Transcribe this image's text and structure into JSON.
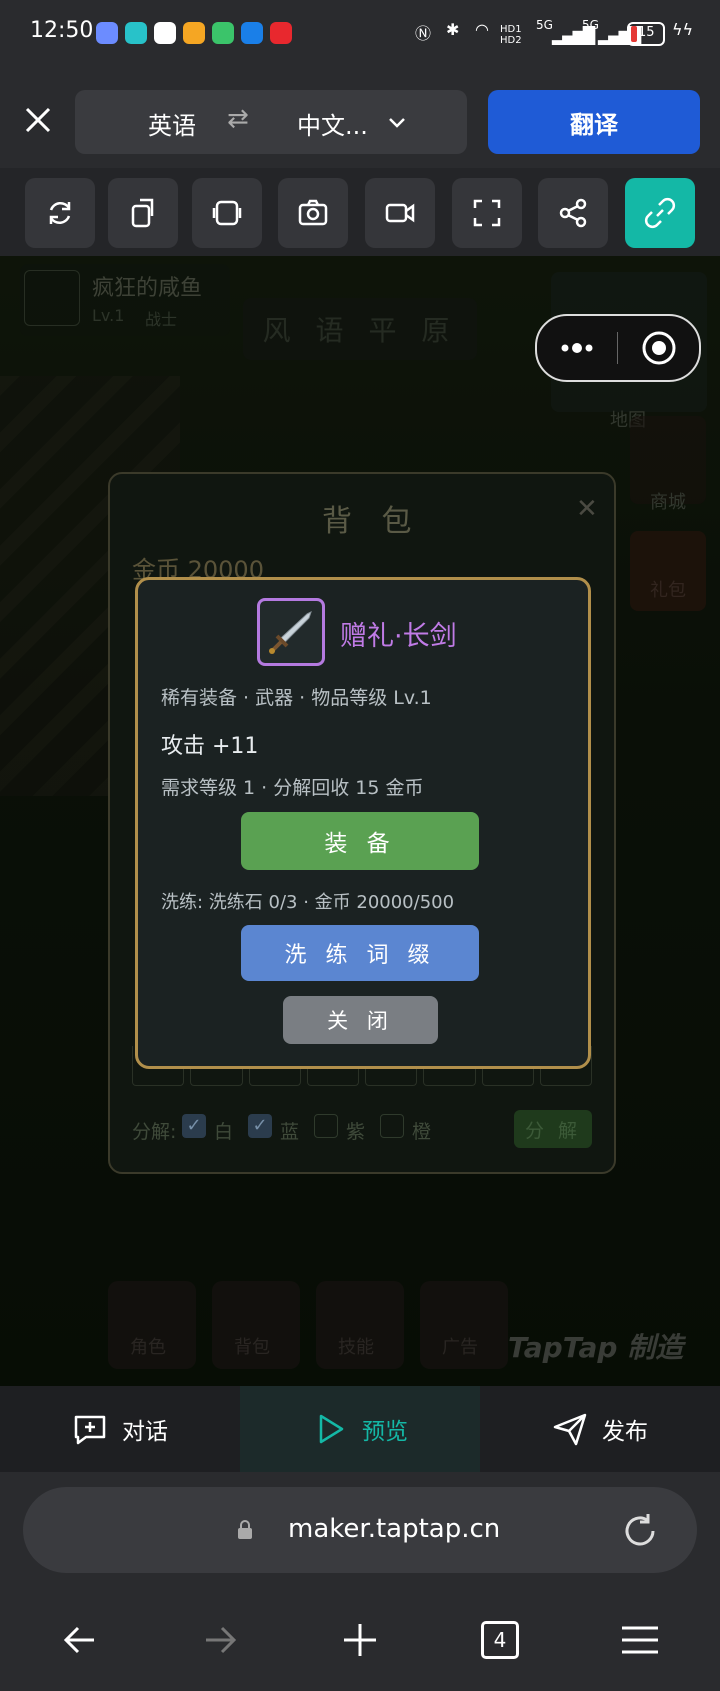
{
  "status_bar": {
    "time": "12:50",
    "battery": "15",
    "signal1": "5G",
    "signal2": "5G",
    "hd": "HD1 HD2"
  },
  "translate_bar": {
    "source_lang": "英语",
    "swap_symbol": "⇄",
    "target_lang": "中文...",
    "translate_label": "翻译"
  },
  "game": {
    "player_name": "疯狂的咸鱼",
    "player_level": "Lv.1",
    "player_class": "战士",
    "area_name": "风 语 平 原",
    "side_labels": [
      "地图",
      "商城",
      "礼包"
    ],
    "bottom_menu": [
      "角色",
      "背包",
      "技能",
      "广告"
    ],
    "watermark": "TapTap 制造"
  },
  "backpack": {
    "title": "背 包",
    "gold": "金币 20000",
    "decompose_label": "分解:",
    "filters": [
      {
        "label": "白",
        "checked": true
      },
      {
        "label": "蓝",
        "checked": true
      },
      {
        "label": "紫",
        "checked": false
      },
      {
        "label": "橙",
        "checked": false
      }
    ],
    "decompose_button": "分 解"
  },
  "item": {
    "icon": "sword-icon",
    "name": "赠礼·长剑",
    "meta": "稀有装备 · 武器 · 物品等级 Lv.1",
    "stat": "攻击 +11",
    "requirement": "需求等级 1 · 分解回收 15 金币",
    "equip_button": "装 备",
    "reroll_info": "洗练: 洗练石 0/3 · 金币 20000/500",
    "reroll_button": "洗 练 词 缀",
    "close_button": "关 闭"
  },
  "bottom_tabs": [
    {
      "label": "对话",
      "icon": "chat-plus-icon"
    },
    {
      "label": "预览",
      "icon": "play-icon"
    },
    {
      "label": "发布",
      "icon": "send-icon"
    }
  ],
  "browser": {
    "url": "maker.taptap.cn",
    "tab_count": "4"
  },
  "colors": {
    "accent_blue": "#1f5bd6",
    "teal": "#14b8a6",
    "equip_green": "#5aa152",
    "reroll_blue": "#5b86d1",
    "item_purple": "#c07be6",
    "gold_border": "#b18f4b"
  }
}
